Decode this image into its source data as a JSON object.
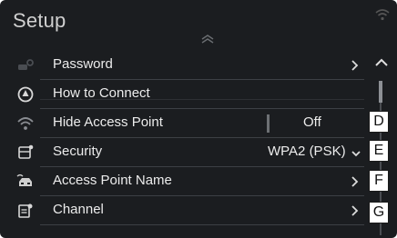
{
  "header": {
    "title": "Setup"
  },
  "rows": [
    {
      "label": "Password",
      "icon": "car-key-icon"
    },
    {
      "label": "How to Connect",
      "icon": "info-icon"
    },
    {
      "label": "Hide Access Point",
      "icon": "wifi-icon",
      "value": "Off"
    },
    {
      "label": "Security",
      "icon": "phone-settings-icon",
      "value": "WPA2 (PSK)"
    },
    {
      "label": "Access Point Name",
      "icon": "car-wifi-icon"
    },
    {
      "label": "Channel",
      "icon": "document-settings-icon"
    }
  ],
  "callouts": [
    "D",
    "E",
    "F",
    "G"
  ],
  "colors": {
    "background": "#1b1d20",
    "text": "#ececec",
    "separator": "#3d4045"
  }
}
